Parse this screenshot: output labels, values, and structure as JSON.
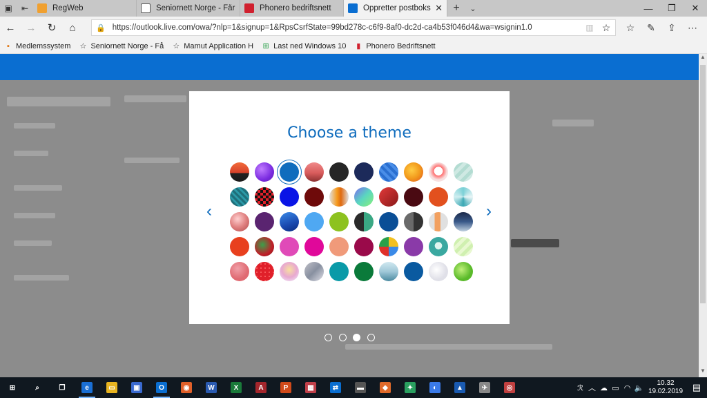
{
  "tabs": [
    {
      "title": "RegWeb",
      "icon": "regweb-icon",
      "color": "#f0a030",
      "active": false,
      "closable": false
    },
    {
      "title": "Seniornett Norge - Får senio",
      "icon": "page-icon",
      "color": "#ffffff",
      "active": false,
      "closable": false
    },
    {
      "title": "Phonero bedriftsnett",
      "icon": "phonero-icon",
      "color": "#d0202e",
      "active": false,
      "closable": false
    },
    {
      "title": "Oppretter postboksen",
      "icon": "outlook-icon",
      "color": "#0a6ed1",
      "active": true,
      "closable": true
    }
  ],
  "address": {
    "url": "https://outlook.live.com/owa/?nlp=1&signup=1&RpsCsrfState=99bd278c-c6f9-8af0-dc2d-ca4b53f046d4&wa=wsignin1.0"
  },
  "bookmarks": [
    {
      "label": "Medlemssystem",
      "icon": "medlem-icon"
    },
    {
      "label": "Seniornett Norge - Få",
      "icon": "star-icon"
    },
    {
      "label": "Mamut Application H",
      "icon": "star-icon"
    },
    {
      "label": "Last ned Windows 10",
      "icon": "windows-icon"
    },
    {
      "label": "Phonero Bedriftsnett",
      "icon": "phonero-icon"
    }
  ],
  "modal": {
    "title": "Choose a theme",
    "selected_index": 2,
    "themes": [
      {
        "name": "theme-1",
        "bg": "linear-gradient(180deg,#f26b3a 0%,#d6402a 55%,#222 55%,#1a1a1a 100%)"
      },
      {
        "name": "theme-2",
        "bg": "radial-gradient(circle at 35% 35%,#c07cff,#7a2be0 60%,#5b1fb0)"
      },
      {
        "name": "theme-3",
        "bg": "#0f6cbd"
      },
      {
        "name": "theme-4",
        "bg": "linear-gradient(180deg,#f08a8a 0%,#d85b5b 55%,#8c3030 100%)"
      },
      {
        "name": "theme-5",
        "bg": "#262626"
      },
      {
        "name": "theme-6",
        "bg": "#1c2a5a"
      },
      {
        "name": "theme-7",
        "bg": "repeating-linear-gradient(45deg,#2a6fd0 0 4px,#4a8ee8 4px 8px)"
      },
      {
        "name": "theme-8",
        "bg": "radial-gradient(circle at 40% 40%,#ffcc44,#f29b1d 50%,#e2531c)"
      },
      {
        "name": "theme-9",
        "bg": "radial-gradient(circle at 50% 45%,#ffffff 30%,#ff6a6a 31%,#f7e0e0 60%)"
      },
      {
        "name": "theme-10",
        "bg": "repeating-linear-gradient(135deg,#cfe9e3 0 5px,#b3dcd2 5px 10px)"
      },
      {
        "name": "theme-11",
        "bg": "repeating-linear-gradient(45deg,#1f6f7a 0 3px,#2b9aa8 3px 6px)"
      },
      {
        "name": "theme-12",
        "bg": "repeating-conic-gradient(#111 0 25%,#e0202a 0 50%) 0 0/8px 8px"
      },
      {
        "name": "theme-13",
        "bg": "#0a14e6"
      },
      {
        "name": "theme-14",
        "bg": "#6e0a0a"
      },
      {
        "name": "theme-15",
        "bg": "linear-gradient(90deg,#e0e0e0 0%,#f59a1e 40%,#e06a10 60%,#e0e0e0 100%)"
      },
      {
        "name": "theme-16",
        "bg": "linear-gradient(135deg,#7a6af0 0%,#5ad6c0 50%,#8af07a 100%)"
      },
      {
        "name": "theme-17",
        "bg": "linear-gradient(135deg,#e23a3a,#8a1a1a)"
      },
      {
        "name": "theme-18",
        "bg": "#4a0a12"
      },
      {
        "name": "theme-19",
        "bg": "#e2501e"
      },
      {
        "name": "theme-20",
        "bg": "conic-gradient(#7ad0d6,#e9f5f6,#3aa8b4,#d0eef0,#7ad0d6)"
      },
      {
        "name": "theme-21",
        "bg": "radial-gradient(circle at 40% 35%,#ffd0d0,#e08080 50%,#b04a4a)"
      },
      {
        "name": "theme-22",
        "bg": "#5a2470"
      },
      {
        "name": "theme-23",
        "bg": "linear-gradient(160deg,#3a8ae8,#1a4ab0 60%,#0a2a80)"
      },
      {
        "name": "theme-24",
        "bg": "#4fa8f2"
      },
      {
        "name": "theme-25",
        "bg": "#8dc21f"
      },
      {
        "name": "theme-26",
        "bg": "linear-gradient(90deg,#2a2a2a 50%,#3aa884 50%)"
      },
      {
        "name": "theme-27",
        "bg": "#0a4e96"
      },
      {
        "name": "theme-28",
        "bg": "linear-gradient(90deg,#6a6a6a 50%,#333 50%)"
      },
      {
        "name": "theme-29",
        "bg": "linear-gradient(90deg,#e0e0e0 30%,#f2a060 30%,#f2a060 60%,#e0e0e0 60%)"
      },
      {
        "name": "theme-30",
        "bg": "linear-gradient(180deg,#1c2a4a 0%,#3a5a8a 50%,#c0d0e0 100%)"
      },
      {
        "name": "theme-31",
        "bg": "#e8401e"
      },
      {
        "name": "theme-32",
        "bg": "radial-gradient(circle at 40% 40%,#3aa04a,#c0202a 60%,#801010)"
      },
      {
        "name": "theme-33",
        "bg": "#e04ab8"
      },
      {
        "name": "theme-34",
        "bg": "#e0089a"
      },
      {
        "name": "theme-35",
        "bg": "#f09a7a"
      },
      {
        "name": "theme-36",
        "bg": "#9a0a4a"
      },
      {
        "name": "theme-37",
        "bg": "conic-gradient(#f2c020 0 25%,#3a8ae8 0 50%,#e0302a 0 75%,#2aa04a 0)"
      },
      {
        "name": "theme-38",
        "bg": "#8a3aa8"
      },
      {
        "name": "theme-39",
        "bg": "radial-gradient(circle at 50% 45%,#dff6f0 25%,#3aa8a0 26%)"
      },
      {
        "name": "theme-40",
        "bg": "repeating-linear-gradient(135deg,#e8f8d0 0 5px,#d0f0b0 5px 10px)"
      },
      {
        "name": "theme-41",
        "bg": "radial-gradient(circle at 40% 35%,#f0a0a8,#e06a72 60%)"
      },
      {
        "name": "theme-42",
        "bg": "radial-gradient(circle,#ff6a6a 20%,#e0202a 21%) 0 0/6px 6px"
      },
      {
        "name": "theme-43",
        "bg": "radial-gradient(circle at 50% 40%,#f8e0a0,#e8a8d0 50%,#f0f0ff)"
      },
      {
        "name": "theme-44",
        "bg": "linear-gradient(135deg,#c0c0c8,#8890a0 50%,#e0e0e8)"
      },
      {
        "name": "theme-45",
        "bg": "#0a9aa8"
      },
      {
        "name": "theme-46",
        "bg": "#0a7a3a"
      },
      {
        "name": "theme-47",
        "bg": "linear-gradient(180deg,#d0e8f0 0%,#a0c8d8 50%,#4a8aa0 100%)"
      },
      {
        "name": "theme-48",
        "bg": "#0a5aa0"
      },
      {
        "name": "theme-49",
        "bg": "radial-gradient(circle at 40% 40%,#ffffff,#e0e0e8 60%)"
      },
      {
        "name": "theme-50",
        "bg": "radial-gradient(circle at 40% 40%,#c0f07a,#5aba2a 60%)"
      }
    ],
    "prev_label": "‹",
    "next_label": "›"
  },
  "pagination": {
    "count": 4,
    "active_index": 2
  },
  "taskbar": {
    "apps": [
      {
        "name": "start-icon",
        "glyph": "⊞",
        "color": "#101820",
        "running": false
      },
      {
        "name": "search-icon",
        "glyph": "⌕",
        "color": "#101820",
        "running": false
      },
      {
        "name": "task-view-icon",
        "glyph": "❐",
        "color": "#101820",
        "running": false
      },
      {
        "name": "edge-icon",
        "glyph": "e",
        "color": "#1a6fd4",
        "running": true
      },
      {
        "name": "file-explorer-icon",
        "glyph": "▭",
        "color": "#e8b420",
        "running": false
      },
      {
        "name": "store-icon",
        "glyph": "▣",
        "color": "#3a6ad0",
        "running": false
      },
      {
        "name": "outlook-app-icon",
        "glyph": "O",
        "color": "#0a6ed1",
        "running": true
      },
      {
        "name": "firefox-icon",
        "glyph": "◉",
        "color": "#e0602a",
        "running": false
      },
      {
        "name": "word-icon",
        "glyph": "W",
        "color": "#2a5ab0",
        "running": false
      },
      {
        "name": "excel-icon",
        "glyph": "X",
        "color": "#1a7a3a",
        "running": false
      },
      {
        "name": "access-icon",
        "glyph": "A",
        "color": "#a4262c",
        "running": false
      },
      {
        "name": "powerpoint-icon",
        "glyph": "P",
        "color": "#d04a1a",
        "running": false
      },
      {
        "name": "app-icon-1",
        "glyph": "▦",
        "color": "#c0404a",
        "running": false
      },
      {
        "name": "teamviewer-icon",
        "glyph": "⇄",
        "color": "#0a6ed1",
        "running": false
      },
      {
        "name": "app-icon-2",
        "glyph": "▬",
        "color": "#555",
        "running": false
      },
      {
        "name": "app-icon-3",
        "glyph": "◆",
        "color": "#e06a2a",
        "running": false
      },
      {
        "name": "app-icon-4",
        "glyph": "✦",
        "color": "#2aa060",
        "running": false
      },
      {
        "name": "app-icon-5",
        "glyph": "◐",
        "color": "#3a7ae8",
        "running": false
      },
      {
        "name": "app-icon-6",
        "glyph": "▲",
        "color": "#1a5ab0",
        "running": false
      },
      {
        "name": "app-icon-7",
        "glyph": "✈",
        "color": "#888",
        "running": false
      },
      {
        "name": "app-icon-8",
        "glyph": "◎",
        "color": "#c04040",
        "running": false
      }
    ],
    "clock_time": "10.32",
    "clock_date": "19.02.2019"
  }
}
